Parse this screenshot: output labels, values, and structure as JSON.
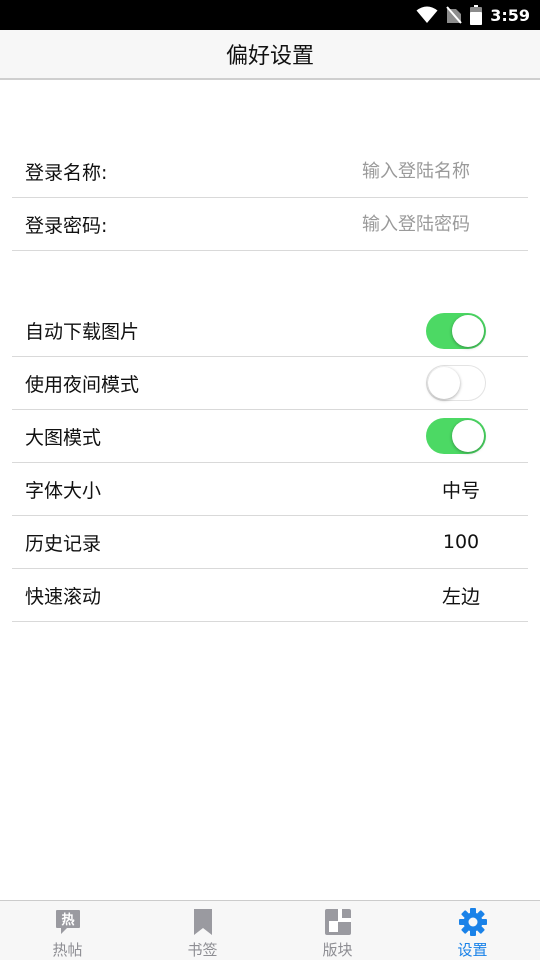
{
  "status_bar": {
    "time": "3:59"
  },
  "header": {
    "title": "偏好设置"
  },
  "account": {
    "username": {
      "label": "登录名称:",
      "placeholder": "输入登陆名称",
      "value": ""
    },
    "password": {
      "label": "登录密码:",
      "placeholder": "输入登陆密码",
      "value": ""
    }
  },
  "settings": {
    "auto_download_images": {
      "label": "自动下载图片",
      "enabled": true
    },
    "night_mode": {
      "label": "使用夜间模式",
      "enabled": false
    },
    "large_image_mode": {
      "label": "大图模式",
      "enabled": true
    },
    "font_size": {
      "label": "字体大小",
      "value": "中号"
    },
    "history": {
      "label": "历史记录",
      "value": "100"
    },
    "fast_scroll": {
      "label": "快速滚动",
      "value": "左边"
    }
  },
  "tabbar": {
    "items": [
      {
        "label": "热帖",
        "icon": "hot-post-icon",
        "active": false
      },
      {
        "label": "书签",
        "icon": "bookmark-icon",
        "active": false
      },
      {
        "label": "版块",
        "icon": "board-icon",
        "active": false
      },
      {
        "label": "设置",
        "icon": "gear-icon",
        "active": true
      }
    ]
  },
  "colors": {
    "toggle_on": "#4cd964",
    "tab_active": "#1a82e8",
    "tab_inactive": "#8e8e93"
  }
}
